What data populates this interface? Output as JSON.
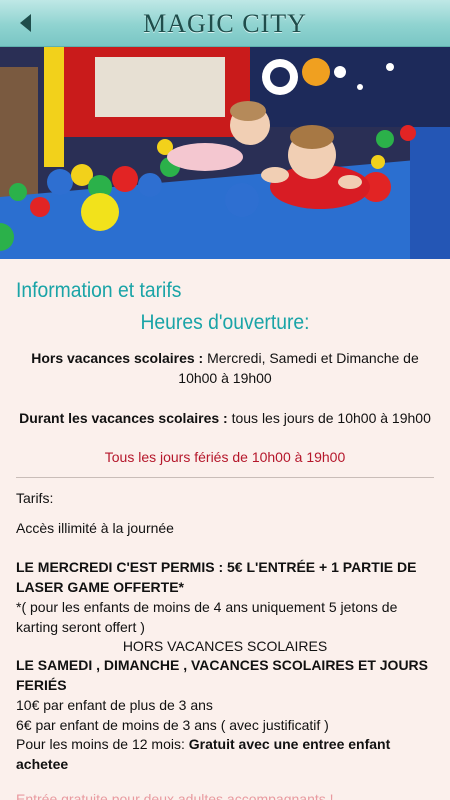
{
  "header": {
    "title": "MAGIC CITY",
    "back_icon": "back-arrow-icon"
  },
  "hero": {
    "description_icon": "photo-kids-ball-pit"
  },
  "info": {
    "section_title": "Information et tarifs",
    "hours_title": "Heures d'ouverture:",
    "hors_label": "Hors vacances scolaires :",
    "hors_value": " Mercredi, Samedi et Dimanche de",
    "hors_value2": "10h00 à 19h00",
    "durant_label": "Durant les vacances scolaires :",
    "durant_value": " tous les jours de 10h00 à 19h00",
    "feries": "Tous les jours fériés de 10h00 à 19h00",
    "tarifs_label": "Tarifs:",
    "acces": "Accès illimité à la journée",
    "mercredi_line1": "LE MERCREDI C'EST PERMIS : 5€ L'ENTRÉE + 1 PARTIE DE",
    "mercredi_line2": "LASER GAME OFFERTE*",
    "note_line1": "*( pour les enfants de moins de 4 ans uniquement 5 jetons de",
    "note_line2": "karting seront offert )",
    "hors_vacances_caps": "HORS VACANCES SCOLAIRES",
    "samedi_line1": "LE SAMEDI , DIMANCHE , VACANCES SCOLAIRES ET JOURS",
    "samedi_line2": "FERIÉS",
    "price1": "10€ par enfant de plus de 3 ans",
    "price2": "6€ par enfant de moins de 3 ans ( avec justificatif )",
    "moins12_label": "Pour les moins de 12 mois: ",
    "moins12_bold": "Gratuit avec une entree enfant",
    "moins12_bold2": "achetee",
    "cutoff": "Entrée gratuite pour deux adultes accompagnants !"
  },
  "colors": {
    "accent": "#1aa4a7",
    "header": "#8fd3d0",
    "background": "#fbf0ec",
    "highlight_red": "#b5172b"
  }
}
